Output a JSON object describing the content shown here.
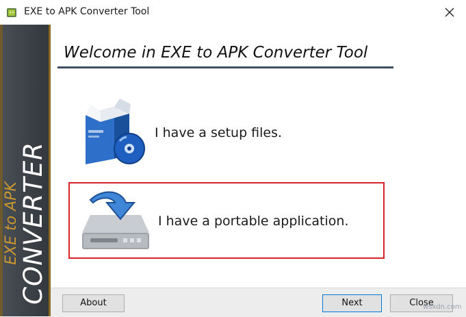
{
  "window": {
    "title": "EXE to APK Converter Tool",
    "close_glyph": "✕"
  },
  "side_panel": {
    "small_text": "EXE to APK",
    "big_text": "CONVERTER"
  },
  "main": {
    "welcome_title": "Welcome in EXE to APK Converter Tool",
    "options": [
      {
        "label": "I have a setup files.",
        "icon": "setup-box-cd-icon",
        "selected": false
      },
      {
        "label": "I have a portable application.",
        "icon": "hard-drive-download-icon",
        "selected": true
      }
    ]
  },
  "buttons": {
    "about": "About",
    "next": "Next",
    "close": "Close"
  },
  "watermark": "wsxdn.com",
  "colors": {
    "highlight_border": "#d92128",
    "rule": "#3e4f63",
    "side_gold": "#c9962f"
  }
}
